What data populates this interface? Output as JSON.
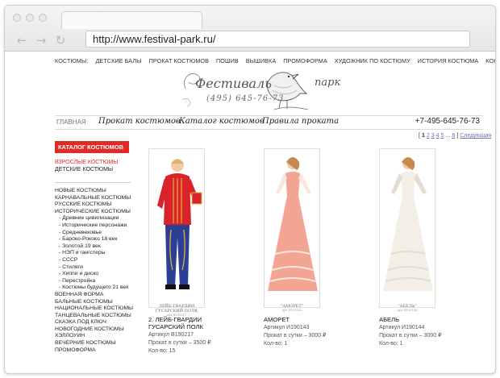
{
  "browser": {
    "url": "http://www.festival-park.ru/",
    "nav_icons": [
      "back-arrow-icon",
      "forward-arrow-icon",
      "reload-icon"
    ]
  },
  "top_menu": [
    "КОСТЮМЫ:",
    "ДЕТСКИЕ БАЛЫ",
    "ПРОКАТ КОСТЮМОВ",
    "ПОШИВ",
    "ВЫШИВКА",
    "ПРОМОФОРМА",
    "ХУДОЖНИК ПО КОСТЮМУ",
    "ИСТОРИЯ КОСТЮМА",
    "КОНТАКТЫ"
  ],
  "logo": {
    "title": "Фестиваль",
    "word": "парк",
    "phone": "(495) 645-76-73"
  },
  "main_nav": {
    "home": "ГЛАВНАЯ",
    "sections": [
      "Прокат костюмов",
      "Каталог костюмов",
      "Правила проката"
    ],
    "phone": "+7-495-645-76-73"
  },
  "pager": {
    "open": "[",
    "current": "1",
    "pages": [
      "2",
      "3",
      "4",
      "5"
    ],
    "ellipsis": "...",
    "last": "6",
    "close": "]",
    "next": "Следующая"
  },
  "sidebar": {
    "heading": "КАТАЛОГ КОСТЮМОВ",
    "adult": "ВЗРОСЛЫЕ КОСТЮМЫ",
    "kids": "ДЕТСКИЕ КОСТЮМЫ",
    "categories": [
      {
        "label": "НОВЫЕ КОСТЮМЫ",
        "sub": false
      },
      {
        "label": "КАРНАВАЛЬНЫЕ КОСТЮМЫ",
        "sub": false
      },
      {
        "label": "РУССКИЕ КОСТЮМЫ",
        "sub": false
      },
      {
        "label": "ИСТОРИЧЕСКИЕ КОСТЮМЫ",
        "sub": false
      },
      {
        "label": "- Древние цивилизации",
        "sub": true
      },
      {
        "label": "- Исторические персонажи",
        "sub": true
      },
      {
        "label": "- Средневековье",
        "sub": true
      },
      {
        "label": "- Бароко-Рококо 18 век",
        "sub": true
      },
      {
        "label": "- Золотой 19 век",
        "sub": true
      },
      {
        "label": "- НЭП и гангстеры",
        "sub": true
      },
      {
        "label": "- СССР",
        "sub": true
      },
      {
        "label": "- Стиляги",
        "sub": true
      },
      {
        "label": "- Хиппи и диско",
        "sub": true
      },
      {
        "label": "- Перестройка",
        "sub": true
      },
      {
        "label": "- Костюмы будущего 21 век",
        "sub": true
      },
      {
        "label": "ВОЕННАЯ ФОРМА",
        "sub": false
      },
      {
        "label": "БАЛЬНЫЕ КОСТЮМЫ",
        "sub": false
      },
      {
        "label": "НАЦИОНАЛЬНЫЕ КОСТЮМЫ",
        "sub": false
      },
      {
        "label": "ТАНЦЕВАЛЬНЫЕ КОСТЮМЫ",
        "sub": false
      },
      {
        "label": "СКАЗКА ПОД КЛЮЧ",
        "sub": false
      },
      {
        "label": "НОВОГОДНИЕ КОСТЮМЫ",
        "sub": false
      },
      {
        "label": "ХЭЛЛОУИН",
        "sub": false
      },
      {
        "label": "ВЕЧЕРНИЕ КОСТЮМЫ",
        "sub": false
      },
      {
        "label": "ПРОМОФОРМА",
        "sub": false
      }
    ]
  },
  "products": [
    {
      "caption": "ЛЕЙБ-ГВАРДИИ ГУСАРСКИЙ ПОЛК",
      "caption_article": "Арт В190217",
      "name": "2. ЛЕЙБ-ГВАРДИИ ГУСАРСКИЙ ПОЛК",
      "article": "Артикул В190217",
      "price": "Прокат в сутки – 3500 ₽",
      "qty": "Кол-во: 15",
      "image": "hussar-uniform",
      "colors": {
        "jacket": "#d8232a",
        "trousers": "#2b3f96",
        "braid": "#e0b23a"
      }
    },
    {
      "caption": "\"АМОРЕТ\"",
      "caption_article": "Арт И190143",
      "name": "АМОРЕТ",
      "article": "Артикул И190143",
      "price": "Прокат в сутки – 3000 ₽",
      "qty": "Кол-во: 1",
      "image": "pink-ball-gown",
      "colors": {
        "dress": "#f2a592",
        "trim": "#fbe7df"
      }
    },
    {
      "caption": "\"АБЕЛЬ\"",
      "caption_article": "Арт И190144",
      "name": "АБЕЛЬ",
      "article": "Артикул И190144",
      "price": "Прокат в сутки – 3000 ₽",
      "qty": "Кол-во: 1",
      "image": "white-ball-gown",
      "colors": {
        "dress": "#f4efe6",
        "trim": "#e4dccd"
      }
    }
  ],
  "colors": {
    "accent": "#e02a25",
    "link": "#6c72b7"
  }
}
